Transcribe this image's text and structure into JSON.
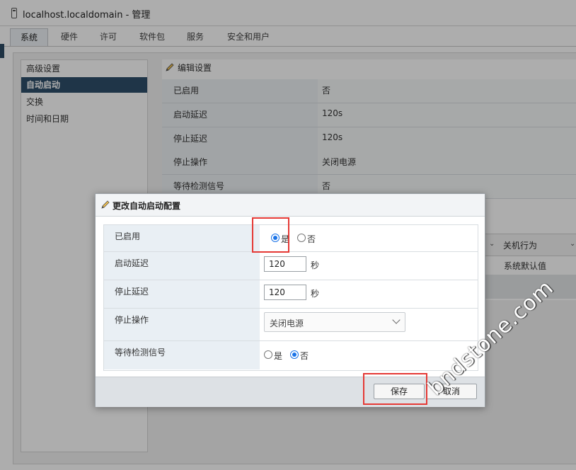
{
  "window": {
    "title": "localhost.localdomain - 管理"
  },
  "tabs": [
    "系统",
    "硬件",
    "许可",
    "软件包",
    "服务",
    "安全和用户"
  ],
  "nav": [
    "高级设置",
    "自动启动",
    "交换",
    "时间和日期"
  ],
  "toolbar": {
    "edit_settings": "编辑设置"
  },
  "settings": [
    {
      "key": "已启用",
      "value": "否"
    },
    {
      "key": "启动延迟",
      "value": "120s"
    },
    {
      "key": "停止延迟",
      "value": "120s"
    },
    {
      "key": "停止操作",
      "value": "关闭电源"
    },
    {
      "key": "等待检测信号",
      "value": "否"
    }
  ],
  "grid": {
    "column": "关机行为",
    "cell": "系统默认值"
  },
  "dialog": {
    "title": "更改自动启动配置",
    "enabled": {
      "label": "已启用",
      "yes": "是",
      "no": "否",
      "selected": "yes"
    },
    "start_delay": {
      "label": "启动延迟",
      "value": "120",
      "unit": "秒"
    },
    "stop_delay": {
      "label": "停止延迟",
      "value": "120",
      "unit": "秒"
    },
    "stop_action": {
      "label": "停止操作",
      "value": "关闭电源"
    },
    "heartbeat": {
      "label": "等待检测信号",
      "yes": "是",
      "no": "否",
      "selected": "no"
    },
    "save": "保存",
    "cancel": "取消"
  },
  "watermark": "bndstone.com",
  "colors": {
    "highlight": "#e53935",
    "nav_selected": "#2e4e6a",
    "radio": "#1a73e8"
  },
  "icons": {
    "title": "host-icon",
    "edit": "pencil-icon"
  }
}
